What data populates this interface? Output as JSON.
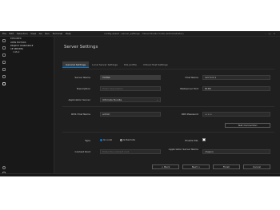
{
  "titlebar": {
    "menu": [
      "File",
      "Edit",
      "Selection",
      "View",
      "Go",
      "Run",
      "Terminal",
      "Help"
    ],
    "title": "config-assist - server_settings - Visual Studio Code (Administrator)"
  },
  "sidebar": {
    "header": "EXPLORER",
    "items": [
      {
        "label": "OPEN EDITORS"
      },
      {
        "label": "PROJECT WORKSPACE"
      },
      {
        "label": "CE SERVERS"
      },
      {
        "label": "UnBall"
      }
    ]
  },
  "page": {
    "title": "Server Settings"
  },
  "tabs": [
    {
      "label": "General Settings",
      "active": true
    },
    {
      "label": "Local Server Settings",
      "active": false
    },
    {
      "label": "SSL profile",
      "active": false
    },
    {
      "label": "Virtual Host Settings",
      "active": false
    }
  ],
  "form": {
    "server_name": {
      "label": "Server Name",
      "value": "TCESR"
    },
    "host_name": {
      "label": "Host Name",
      "value": "127.0.0.1"
    },
    "description": {
      "label": "Description",
      "placeholder": "Enter description"
    },
    "webserver_port": {
      "label": "Webserver Port",
      "value": "8180"
    },
    "application_server": {
      "label": "Application Server",
      "value": "Ultimate Bundle"
    },
    "rds_host_name": {
      "label": "RDS Host Name",
      "value": "admin"
    },
    "rds_password": {
      "label": "RDS Password",
      "value": "•••••"
    },
    "test_connection": {
      "label": "Test Connection"
    },
    "type": {
      "label": "Type",
      "options": [
        "Is Local",
        "Is Remote"
      ],
      "selected": "Is Local"
    },
    "enable_ssl": {
      "label": "Enable SSL",
      "checked": false
    },
    "context_root": {
      "label": "Context Root",
      "placeholder": "Enter the context root"
    },
    "app_server_name": {
      "label": "Application Server Name",
      "value": "cfusion"
    }
  },
  "buttons": {
    "back": "< Back",
    "next": "Next >",
    "finish": "Finish",
    "cancel": "Cancel"
  }
}
